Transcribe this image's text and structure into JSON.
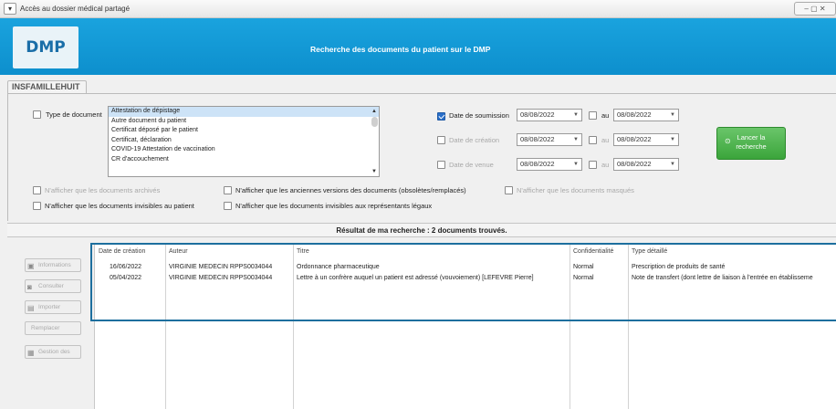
{
  "window": {
    "menu_glyph": "▾",
    "title": "Accès au dossier médical partagé",
    "controls": "–  ▢  ✕"
  },
  "header": {
    "logo": "DMP",
    "title": "Recherche des documents du patient sur le DMP"
  },
  "patient": {
    "name": "INSFAMILLEHUIT"
  },
  "filters": {
    "type_document_label": "Type de document",
    "type_document_checked": false,
    "document_types": [
      "Attestation de dépistage",
      "Autre document du patient",
      "Certificat déposé par le patient",
      "Certificat, déclaration",
      "COVID-19 Attestation de vaccination",
      "CR d'accouchement"
    ],
    "selected_type_index": 0,
    "date_soumission": {
      "label": "Date de soumission",
      "from": "08/08/2022",
      "to": "08/08/2022",
      "checked": true
    },
    "date_creation": {
      "label": "Date de création",
      "from": "08/08/2022",
      "to": "08/08/2022",
      "checked": false
    },
    "date_venue": {
      "label": "Date de venue",
      "from": "08/08/2022",
      "to": "08/08/2022",
      "checked": false
    },
    "au_label": "au",
    "options": {
      "archived": "N'afficher que les documents archivés",
      "old_versions": "N'afficher que les anciennes versions des documents (obsolètes/remplacés)",
      "masked": "N'afficher que les documents masqués",
      "invisible_patient": "N'afficher que les documents invisibles au patient",
      "invisible_reps": "N'afficher que les documents invisibles aux représentants légaux"
    },
    "search_button": {
      "line1": "Lancer la",
      "line2": "recherche"
    }
  },
  "results": {
    "summary": "Résultat de ma recherche : 2 documents trouvés.",
    "columns": {
      "date": "Date de création",
      "author": "Auteur",
      "title": "Titre",
      "confidentiality": "Confidentialité",
      "type": "Type détaillé"
    },
    "rows": [
      {
        "date": "16/06/2022",
        "author": "VIRGINIE MEDECIN RPPS0034044",
        "title": "Ordonnance pharmaceutique",
        "confidentiality": "Normal",
        "type": "Prescription de produits de santé"
      },
      {
        "date": "05/04/2022",
        "author": "VIRGINIE MEDECIN RPPS0034044",
        "title": "Lettre à un confrère auquel un patient est adressé (vouvoiement) [LEFEVRE Pierre]",
        "confidentiality": "Normal",
        "type": "Note de transfert (dont lettre de liaison à l'entrée en établisseme"
      }
    ]
  },
  "toolbar": {
    "buttons": [
      "Informations",
      "Consulter",
      "Importer",
      "Remplacer",
      "Gestion des"
    ]
  },
  "colors": {
    "header_blue": "#1aa3de",
    "search_green": "#3ba53b",
    "highlight_border": "#1d6f9e"
  }
}
